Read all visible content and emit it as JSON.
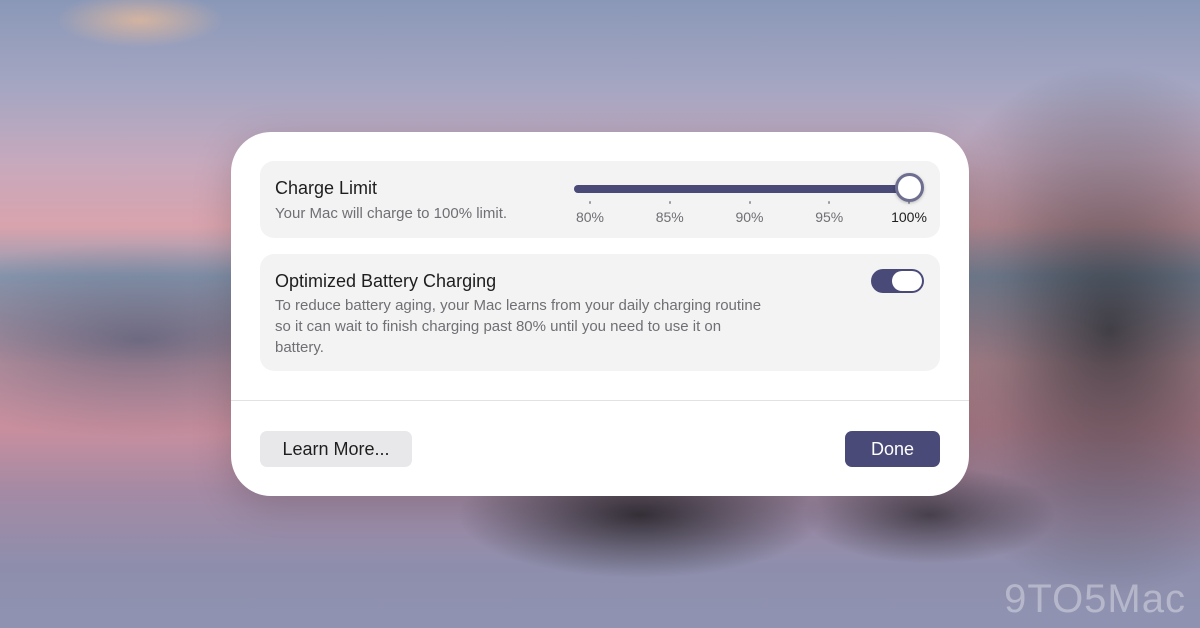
{
  "dialog": {
    "charge_limit": {
      "title": "Charge Limit",
      "subtitle": "Your Mac will charge to 100% limit.",
      "slider": {
        "ticks": [
          "80%",
          "85%",
          "90%",
          "95%",
          "100%"
        ],
        "selected_index": 4,
        "selected_value": "100%"
      }
    },
    "optimized_charging": {
      "title": "Optimized Battery Charging",
      "description_lines": [
        "To reduce battery aging, your Mac learns from your daily charging routine",
        "so it can wait to finish charging past 80% until you need to use it on",
        "battery."
      ],
      "toggle_on": true
    },
    "buttons": {
      "learn_more": "Learn More...",
      "done": "Done"
    }
  },
  "colors": {
    "accent": "#494a78",
    "card_background": "#f3f3f4",
    "secondary_text": "#6f6f74"
  },
  "watermark": "9TO5Mac"
}
